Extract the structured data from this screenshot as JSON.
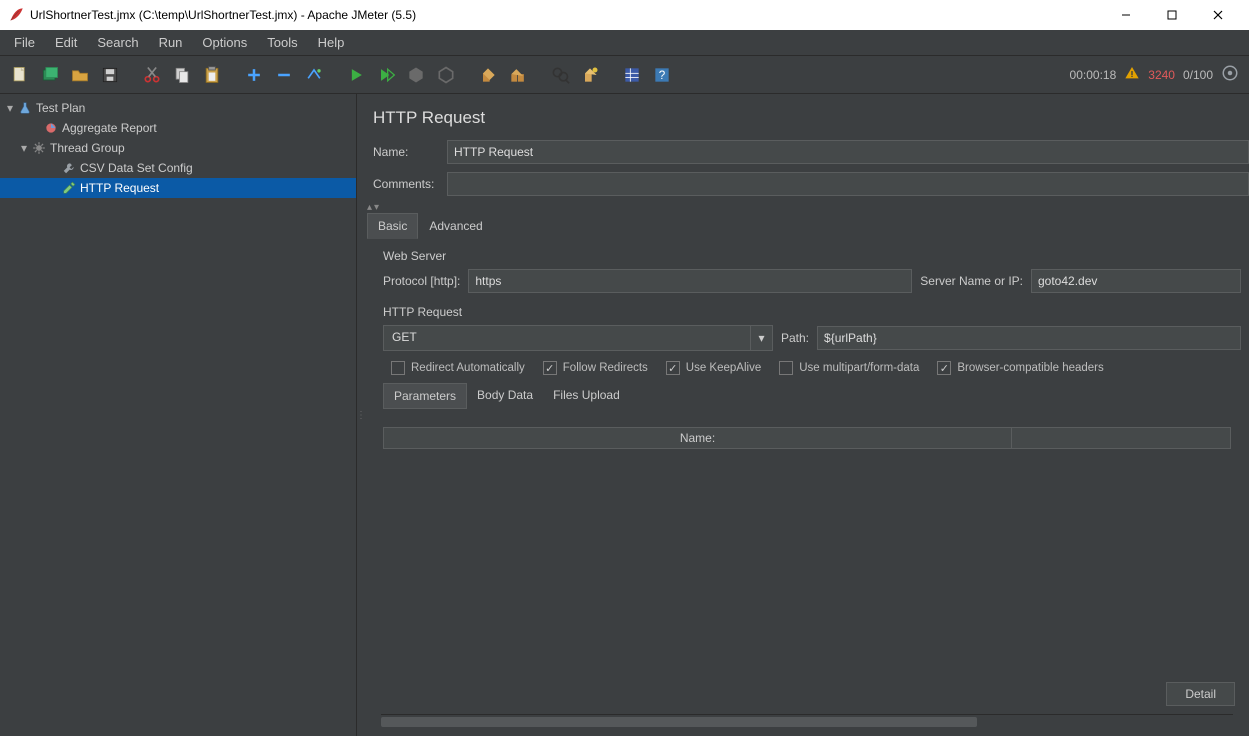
{
  "window": {
    "title": "UrlShortnerTest.jmx (C:\\temp\\UrlShortnerTest.jmx) - Apache JMeter (5.5)"
  },
  "menu": {
    "file": "File",
    "edit": "Edit",
    "search": "Search",
    "run": "Run",
    "options": "Options",
    "tools": "Tools",
    "help": "Help"
  },
  "status": {
    "elapsed": "00:00:18",
    "errors": "3240",
    "threads": "0/100"
  },
  "tree": {
    "test_plan": "Test Plan",
    "aggregate_report": "Aggregate Report",
    "thread_group": "Thread Group",
    "csv_config": "CSV Data Set Config",
    "http_request": "HTTP Request"
  },
  "form": {
    "title": "HTTP Request",
    "name_label": "Name:",
    "name_value": "HTTP Request",
    "comments_label": "Comments:",
    "comments_value": "",
    "tab_basic": "Basic",
    "tab_advanced": "Advanced",
    "web_server_label": "Web Server",
    "protocol_label": "Protocol [http]:",
    "protocol_value": "https",
    "server_label": "Server Name or IP:",
    "server_value": "goto42.dev",
    "http_request_label": "HTTP Request",
    "method_value": "GET",
    "path_label": "Path:",
    "path_value": "${urlPath}",
    "chk_redirect_auto": "Redirect Automatically",
    "chk_follow_redirects": "Follow Redirects",
    "chk_keepalive": "Use KeepAlive",
    "chk_multipart": "Use multipart/form-data",
    "chk_browser_headers": "Browser-compatible headers",
    "subtab_parameters": "Parameters",
    "subtab_body": "Body Data",
    "subtab_files": "Files Upload",
    "param_col_name": "Name:",
    "detail_button": "Detail"
  }
}
